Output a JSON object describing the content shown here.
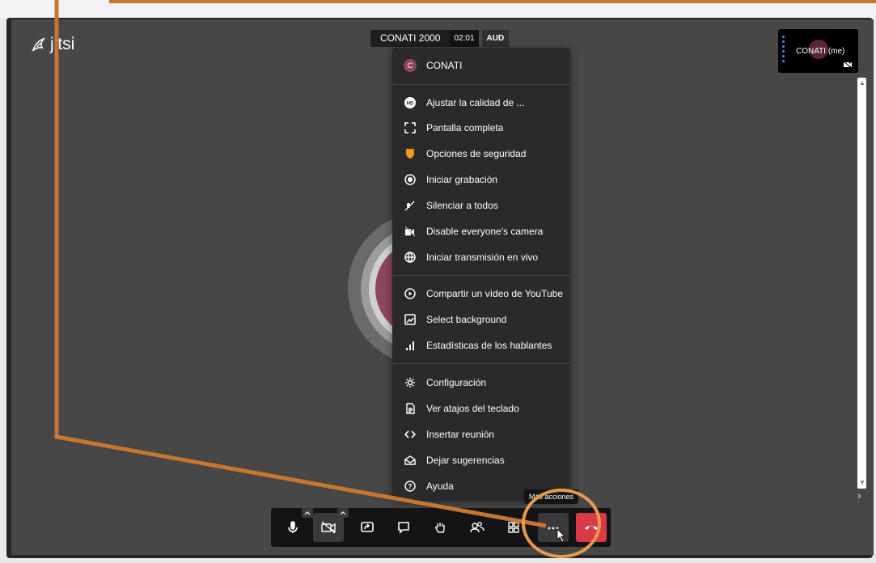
{
  "app": {
    "logo_text": "jitsi"
  },
  "header": {
    "meeting_name": "CONATI 2000",
    "timer": "02:01",
    "audio_badge": "AUD"
  },
  "thumbnail": {
    "name": "CONATI (me)"
  },
  "tooltip": "Más acciones",
  "menu": {
    "user": {
      "initial": "C",
      "name": "CONATI"
    },
    "items": [
      {
        "label": "Ajustar la calidad de ...",
        "icon": "hd-icon"
      },
      {
        "label": "Pantalla completa",
        "icon": "fullscreen-icon"
      },
      {
        "label": "Opciones de seguridad",
        "icon": "security-shield-icon"
      },
      {
        "label": "Iniciar grabación",
        "icon": "record-icon"
      },
      {
        "label": "Silenciar a todos",
        "icon": "mute-all-icon"
      },
      {
        "label": "Disable everyone's camera",
        "icon": "camera-off-all-icon"
      },
      {
        "label": "Iniciar transmisión en vivo",
        "icon": "livestream-icon"
      },
      {
        "label": "Compartir un vídeo de YouTube",
        "icon": "play-video-icon"
      },
      {
        "label": "Select background",
        "icon": "background-icon"
      },
      {
        "label": "Estadísticas de los hablantes",
        "icon": "stats-icon"
      },
      {
        "label": "Configuración",
        "icon": "gear-icon"
      },
      {
        "label": "Ver atajos del teclado",
        "icon": "keyboard-shortcuts-icon"
      },
      {
        "label": "Insertar reunión",
        "icon": "embed-code-icon"
      },
      {
        "label": "Dejar sugerencias",
        "icon": "feedback-icon"
      },
      {
        "label": "Ayuda",
        "icon": "help-icon"
      }
    ]
  },
  "colors": {
    "accent_security": "#f29811",
    "hangup": "#d83a49",
    "annotation": "#c8762f",
    "avatar": "#8d4660"
  }
}
